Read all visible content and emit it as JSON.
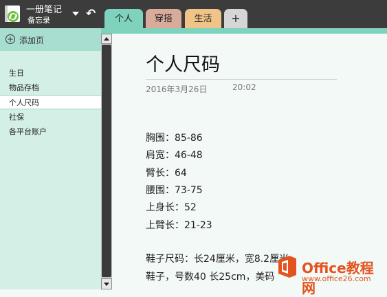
{
  "notebook": {
    "name": "一册笔记",
    "section": "备忘录"
  },
  "tabs": [
    {
      "label": "个人",
      "active": true
    },
    {
      "label": "穿搭"
    },
    {
      "label": "生活"
    },
    {
      "label": "+"
    }
  ],
  "sidebar": {
    "add_page": "添加页",
    "pages": [
      "生日",
      "物品存档",
      "个人尺码",
      "社保",
      "各平台账户"
    ],
    "selected_index": 2
  },
  "note": {
    "title": "个人尺码",
    "date": "2016年3月26日",
    "time": "20:02",
    "lines": [
      "胸围：85-86",
      "肩宽：46-48",
      "臂长：64",
      "腰围：73-75",
      "上身长：52",
      "上臂长：21-23",
      "鞋子尺码：长24厘米，宽8.2厘米",
      "鞋子，号数40 长25cm，美码"
    ]
  },
  "watermark": {
    "brand": "Office教程网",
    "url": "www.office26.com"
  },
  "colors": {
    "tab_personal": "#7fd3be",
    "tab_outfit": "#d8ab9b",
    "tab_life": "#f0c487",
    "brand_orange": "#e4531f"
  }
}
